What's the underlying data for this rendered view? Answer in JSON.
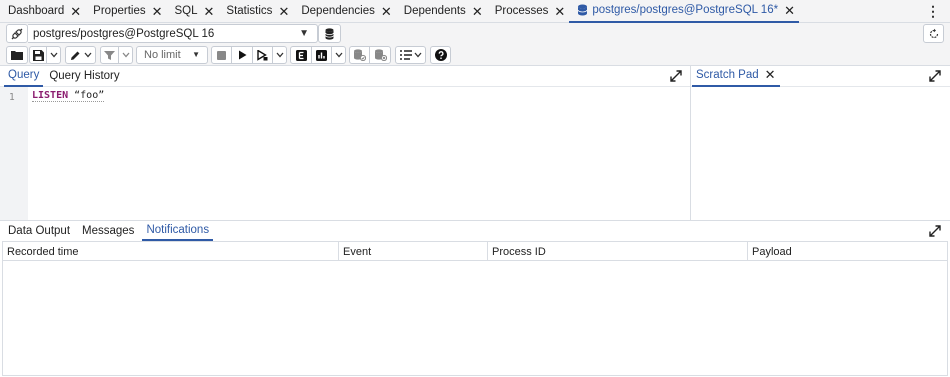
{
  "tabs": [
    {
      "label": "Dashboard",
      "closable": true,
      "active": false
    },
    {
      "label": "Properties",
      "closable": true,
      "active": false
    },
    {
      "label": "SQL",
      "closable": true,
      "active": false
    },
    {
      "label": "Statistics",
      "closable": true,
      "active": false
    },
    {
      "label": "Dependencies",
      "closable": true,
      "active": false
    },
    {
      "label": "Dependents",
      "closable": true,
      "active": false
    },
    {
      "label": "Processes",
      "closable": true,
      "active": false
    },
    {
      "label": "postgres/postgres@PostgreSQL 16*",
      "closable": true,
      "active": true,
      "icon": "database-icon"
    }
  ],
  "close_glyph": "✕",
  "more_glyph": "⋮",
  "connection": {
    "selected": "postgres/postgres@PostgreSQL 16"
  },
  "toolbar": {
    "row_limit": "No limit"
  },
  "editor": {
    "tabs": [
      {
        "label": "Query",
        "active": true
      },
      {
        "label": "Query History",
        "active": false
      }
    ],
    "line_number": "1",
    "code_keyword": "LISTEN",
    "code_rest": " “foo”"
  },
  "scratch": {
    "tab_label": "Scratch Pad"
  },
  "results": {
    "tabs": [
      {
        "label": "Data Output",
        "active": false
      },
      {
        "label": "Messages",
        "active": false
      },
      {
        "label": "Notifications",
        "active": true
      }
    ],
    "columns": [
      "Recorded time",
      "Event",
      "Process ID",
      "Payload"
    ]
  },
  "colors": {
    "accent": "#2f5aa6",
    "keyword": "#8b1c6f",
    "border": "#d9dde3"
  }
}
